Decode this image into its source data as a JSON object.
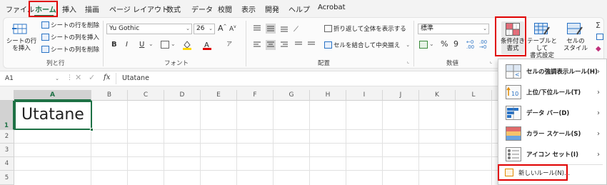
{
  "menubar": {
    "items": [
      "ファイル",
      "ホーム",
      "挿入",
      "描画",
      "ページ レイアウト",
      "数式",
      "データ",
      "校閲",
      "表示",
      "開発",
      "ヘルプ",
      "Acrobat"
    ]
  },
  "ribbon": {
    "rows_cols": {
      "insert_sheet_row_label": "シートの行\nを挿入",
      "delete_row": "シートの行を削除",
      "insert_col": "シートの列を挿入",
      "delete_col": "シートの列を削除",
      "group_label": "列と行"
    },
    "font": {
      "font_name": "Yu Gothic",
      "font_size": "26",
      "grow": "A",
      "shrink": "A",
      "bold": "B",
      "italic": "I",
      "underline": "U",
      "group_label": "フォント"
    },
    "alignment": {
      "wrap_text": "折り返して全体を表示する",
      "merge_center": "セルを結合して中央揃え",
      "group_label": "配置"
    },
    "number": {
      "format": "標準",
      "percent": "%",
      "comma": "9",
      "group_label": "数値"
    },
    "styles": {
      "conditional_format": "条件付き\n書式",
      "table_format": "テーブルとして\n書式設定",
      "cell_styles": "セルの\nスタイル"
    }
  },
  "formula_bar": {
    "name_box": "A1",
    "fx": "fx",
    "content": "Utatane"
  },
  "grid": {
    "columns": [
      "A",
      "B",
      "C",
      "D",
      "E",
      "F",
      "G",
      "H",
      "I",
      "J",
      "K",
      "L"
    ],
    "rows": [
      "1",
      "2",
      "3",
      "4",
      "5"
    ],
    "cell_a1": "Utatane"
  },
  "dropdown": {
    "items": [
      {
        "label": "セルの強調表示ルール(H)",
        "has_submenu": true,
        "icon": "highlight-rules-icon"
      },
      {
        "label": "上位/下位ルール(T)",
        "has_submenu": true,
        "icon": "top-bottom-icon"
      },
      {
        "label": "データ バー(D)",
        "has_submenu": true,
        "icon": "data-bar-icon"
      },
      {
        "label": "カラー スケール(S)",
        "has_submenu": true,
        "icon": "color-scale-icon"
      },
      {
        "label": "アイコン セット(I)",
        "has_submenu": true,
        "icon": "icon-set-icon"
      }
    ],
    "new_rule": "新しいルール(N)..."
  },
  "colors": {
    "highlight": "#e00000",
    "accent_green": "#1e7145"
  }
}
